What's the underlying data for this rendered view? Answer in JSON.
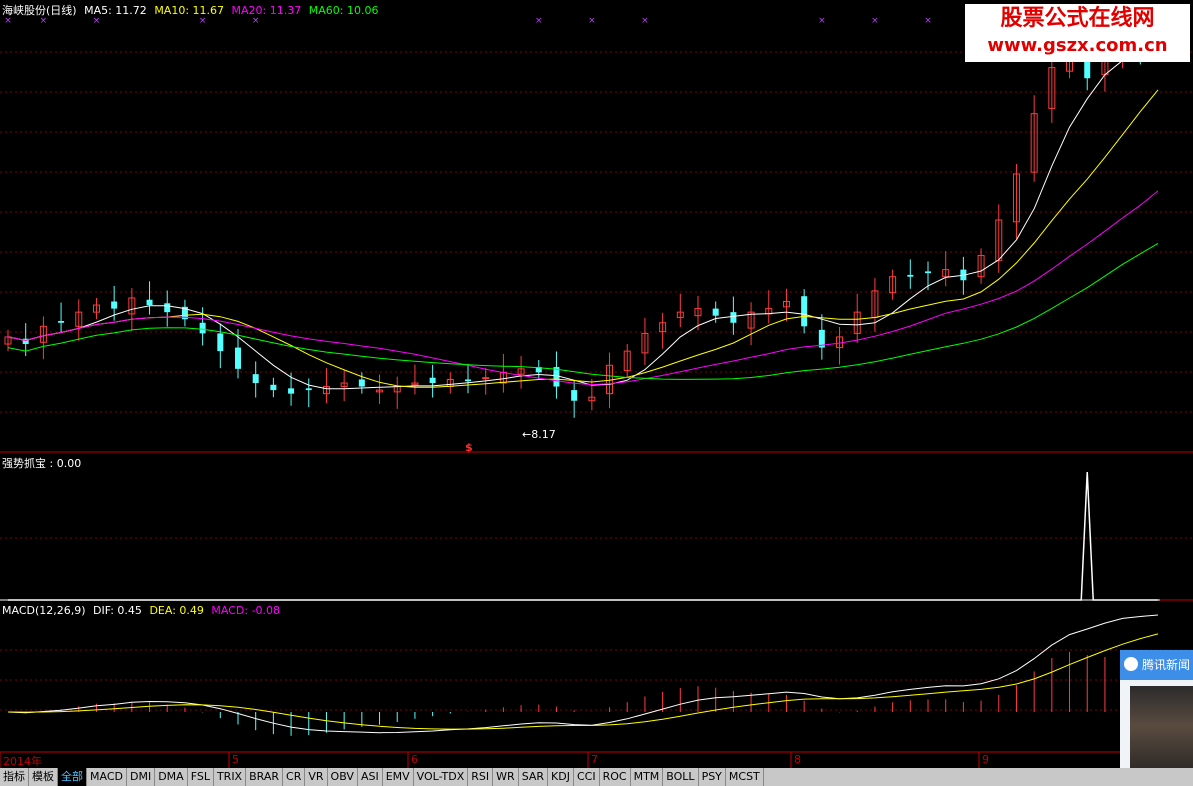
{
  "colors": {
    "ma5": "#ffffff",
    "ma10": "#ffff00",
    "ma20": "#ff00ff",
    "ma60": "#00ff00",
    "up": "#ff3c3c",
    "down": "#54ffff",
    "grid": "#800000",
    "axis": "#c00000"
  },
  "main": {
    "title": "海峡股份(日线)",
    "ma5": "MA5: 11.72",
    "ma10": "MA10: 11.67",
    "ma20": "MA20: 11.37",
    "ma60": "MA60: 10.06",
    "low_marker": "←8.17",
    "buy_marker": "$"
  },
  "indicator1": {
    "label": "强势抓宝 : 0.00"
  },
  "macd": {
    "title": "MACD(12,26,9)",
    "dif": "DIF: 0.45",
    "dea": "DEA: 0.49",
    "macd": "MACD: -0.08"
  },
  "axis": {
    "labels": [
      "2014年",
      "5",
      "6",
      "7",
      "8",
      "9"
    ]
  },
  "watermark": {
    "title": "股票公式在线网",
    "url": "www.gszx.com.cn"
  },
  "news_popup": {
    "label": "腾讯新闻"
  },
  "tabs": [
    "指标",
    "模板",
    "全部",
    "MACD",
    "DMI",
    "DMA",
    "FSL",
    "TRIX",
    "BRAR",
    "CR",
    "VR",
    "OBV",
    "ASI",
    "EMV",
    "VOL-TDX",
    "RSI",
    "WR",
    "SAR",
    "KDJ",
    "CCI",
    "ROC",
    "MTM",
    "BOLL",
    "PSY",
    "MCST"
  ],
  "chart_data": [
    {
      "type": "candlestick",
      "title": "海峡股份(日线)",
      "x_axis": [
        "2014年",
        "5",
        "6",
        "7",
        "8",
        "9"
      ],
      "ma_lines": {
        "MA5": 11.72,
        "MA10": 11.67,
        "MA20": 11.37,
        "MA60": 10.06
      },
      "low_annotation": 8.17,
      "series": {
        "closes": [
          10.2,
          10.0,
          10.5,
          10.6,
          10.9,
          11.1,
          11.0,
          11.3,
          11.1,
          10.9,
          10.7,
          10.3,
          9.8,
          9.3,
          8.9,
          8.7,
          8.6,
          8.7,
          8.8,
          8.9,
          8.8,
          8.7,
          8.8,
          8.9,
          8.9,
          9.0,
          8.95,
          9.05,
          9.2,
          9.3,
          9.2,
          8.8,
          8.4,
          8.5,
          9.4,
          9.8,
          10.3,
          10.6,
          10.9,
          11.0,
          10.8,
          10.6,
          10.9,
          11.0,
          11.2,
          10.5,
          9.9,
          10.2,
          10.9,
          11.5,
          11.9,
          11.9,
          12.0,
          12.1,
          11.8,
          12.5,
          13.5,
          14.8,
          16.5,
          17.8,
          18.0,
          17.5,
          18.2,
          18.5,
          18.3,
          18.6
        ]
      }
    },
    {
      "type": "line",
      "title": "强势抓宝",
      "value": 0.0,
      "peak_index": 61,
      "peak_value": 1
    },
    {
      "type": "macd",
      "title": "MACD(12,26,9)",
      "dif": 0.45,
      "dea": 0.49,
      "macd": -0.08
    }
  ]
}
